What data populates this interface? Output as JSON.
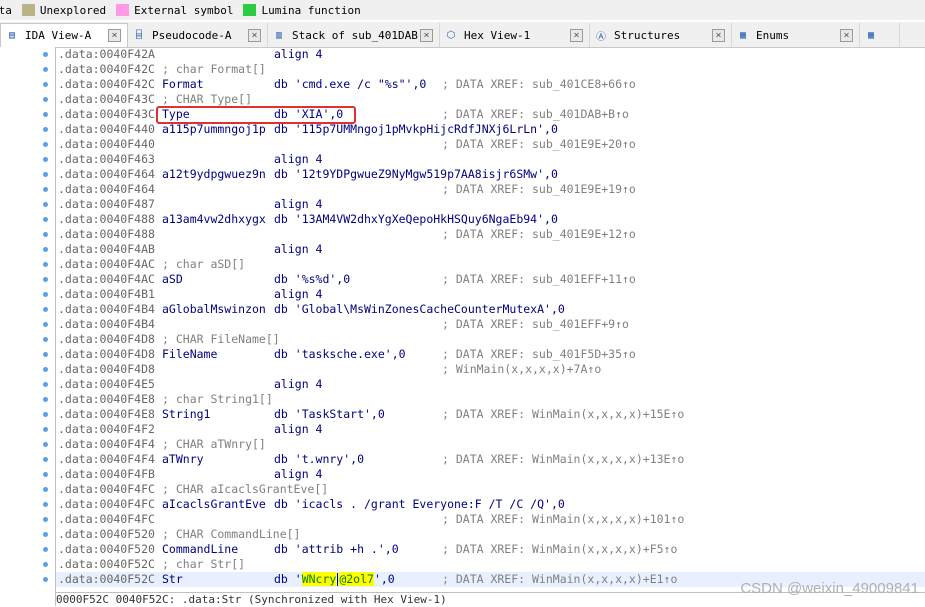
{
  "legend": [
    {
      "label": "ata",
      "color": "#f0f0f0"
    },
    {
      "label": "Unexplored",
      "color": "#bab38a"
    },
    {
      "label": "External symbol",
      "color": "#ff99e6"
    },
    {
      "label": "Lumina function",
      "color": "#2ecc40"
    }
  ],
  "tabs": [
    {
      "label": "IDA View-A",
      "icon": "list-icon",
      "active": true
    },
    {
      "label": "Pseudocode-A",
      "icon": "code-icon",
      "active": false
    },
    {
      "label": "Stack of sub_401DAB",
      "icon": "stack-icon",
      "active": false
    },
    {
      "label": "Hex View-1",
      "icon": "hex-icon",
      "active": false
    },
    {
      "label": "Structures",
      "icon": "struct-icon",
      "active": false
    },
    {
      "label": "Enums",
      "icon": "enum-icon",
      "active": false
    }
  ],
  "lines": [
    {
      "addr": ".data:0040F42A",
      "kind": "code",
      "name": "",
      "mnem": "align 4",
      "xref": ""
    },
    {
      "addr": ".data:0040F42C",
      "kind": "comment",
      "text": "; char Format[]"
    },
    {
      "addr": ".data:0040F42C",
      "kind": "code",
      "name": "Format",
      "mnem": "db 'cmd.exe /c \"%s\"',0",
      "xref": "; DATA XREF: sub_401CE8+66↑o"
    },
    {
      "addr": ".data:0040F43C",
      "kind": "comment",
      "text": "; CHAR Type[]"
    },
    {
      "addr": ".data:0040F43C",
      "kind": "code",
      "name": "Type",
      "mnem": "db 'XIA',0",
      "xref": "; DATA XREF: sub_401DAB+B↑o"
    },
    {
      "addr": ".data:0040F440",
      "kind": "code",
      "name": "a115p7ummngoj1p",
      "mnem": "db '115p7UMMngoj1pMvkpHijcRdfJNXj6LrLn',0",
      "xref": ""
    },
    {
      "addr": ".data:0040F440",
      "kind": "code",
      "name": "",
      "mnem": "",
      "xref": "; DATA XREF: sub_401E9E+20↑o"
    },
    {
      "addr": ".data:0040F463",
      "kind": "code",
      "name": "",
      "mnem": "align 4",
      "xref": ""
    },
    {
      "addr": ".data:0040F464",
      "kind": "code",
      "name": "a12t9ydpgwuez9n",
      "mnem": "db '12t9YDPgwueZ9NyMgw519p7AA8isjr6SMw',0",
      "xref": ""
    },
    {
      "addr": ".data:0040F464",
      "kind": "code",
      "name": "",
      "mnem": "",
      "xref": "; DATA XREF: sub_401E9E+19↑o"
    },
    {
      "addr": ".data:0040F487",
      "kind": "code",
      "name": "",
      "mnem": "align 4",
      "xref": ""
    },
    {
      "addr": ".data:0040F488",
      "kind": "code",
      "name": "a13am4vw2dhxygx",
      "mnem": "db '13AM4VW2dhxYgXeQepoHkHSQuy6NgaEb94',0",
      "xref": ""
    },
    {
      "addr": ".data:0040F488",
      "kind": "code",
      "name": "",
      "mnem": "",
      "xref": "; DATA XREF: sub_401E9E+12↑o"
    },
    {
      "addr": ".data:0040F4AB",
      "kind": "code",
      "name": "",
      "mnem": "align 4",
      "xref": ""
    },
    {
      "addr": ".data:0040F4AC",
      "kind": "comment",
      "text": "; char aSD[]"
    },
    {
      "addr": ".data:0040F4AC",
      "kind": "code",
      "name": "aSD",
      "mnem": "db '%s%d',0",
      "xref": "; DATA XREF: sub_401EFF+11↑o"
    },
    {
      "addr": ".data:0040F4B1",
      "kind": "code",
      "name": "",
      "mnem": "align 4",
      "xref": ""
    },
    {
      "addr": ".data:0040F4B4",
      "kind": "code",
      "name": "aGlobalMswinzon",
      "mnem": "db 'Global\\MsWinZonesCacheCounterMutexA',0",
      "xref": ""
    },
    {
      "addr": ".data:0040F4B4",
      "kind": "code",
      "name": "",
      "mnem": "",
      "xref": "; DATA XREF: sub_401EFF+9↑o"
    },
    {
      "addr": ".data:0040F4D8",
      "kind": "comment",
      "text": "; CHAR FileName[]"
    },
    {
      "addr": ".data:0040F4D8",
      "kind": "code",
      "name": "FileName",
      "mnem": "db 'tasksche.exe',0",
      "xref": "; DATA XREF: sub_401F5D+35↑o"
    },
    {
      "addr": ".data:0040F4D8",
      "kind": "code",
      "name": "",
      "mnem": "",
      "xref": "; WinMain(x,x,x,x)+7A↑o"
    },
    {
      "addr": ".data:0040F4E5",
      "kind": "code",
      "name": "",
      "mnem": "align 4",
      "xref": ""
    },
    {
      "addr": ".data:0040F4E8",
      "kind": "comment",
      "text": "; char String1[]"
    },
    {
      "addr": ".data:0040F4E8",
      "kind": "code",
      "name": "String1",
      "mnem": "db 'TaskStart',0",
      "xref": "; DATA XREF: WinMain(x,x,x,x)+15E↑o"
    },
    {
      "addr": ".data:0040F4F2",
      "kind": "code",
      "name": "",
      "mnem": "align 4",
      "xref": ""
    },
    {
      "addr": ".data:0040F4F4",
      "kind": "comment",
      "text": "; CHAR aTWnry[]"
    },
    {
      "addr": ".data:0040F4F4",
      "kind": "code",
      "name": "aTWnry",
      "mnem": "db 't.wnry',0",
      "xref": "; DATA XREF: WinMain(x,x,x,x)+13E↑o"
    },
    {
      "addr": ".data:0040F4FB",
      "kind": "code",
      "name": "",
      "mnem": "align 4",
      "xref": ""
    },
    {
      "addr": ".data:0040F4FC",
      "kind": "comment",
      "text": "; CHAR aIcaclsGrantEve[]"
    },
    {
      "addr": ".data:0040F4FC",
      "kind": "code",
      "name": "aIcaclsGrantEve",
      "mnem": "db 'icacls . /grant Everyone:F /T /C /Q',0",
      "xref": ""
    },
    {
      "addr": ".data:0040F4FC",
      "kind": "code",
      "name": "",
      "mnem": "",
      "xref": "; DATA XREF: WinMain(x,x,x,x)+101↑o"
    },
    {
      "addr": ".data:0040F520",
      "kind": "comment",
      "text": "; CHAR CommandLine[]"
    },
    {
      "addr": ".data:0040F520",
      "kind": "code",
      "name": "CommandLine",
      "mnem": "db 'attrib +h .',0",
      "xref": "; DATA XREF: WinMain(x,x,x,x)+F5↑o"
    },
    {
      "addr": ".data:0040F52C",
      "kind": "comment",
      "text": "; char Str[]"
    },
    {
      "addr": ".data:0040F52C",
      "kind": "current",
      "name": "Str",
      "mnem_pre": "db '",
      "mnem_hl1": "WNcry",
      "mnem_hl2": "@2ol7",
      "mnem_post": "',0",
      "xref": "; DATA XREF: WinMain(x,x,x,x)+E1↑o"
    }
  ],
  "status": "0000F52C 0040F52C: .data:Str (Synchronized with Hex View-1)",
  "watermark": "CSDN @weixin_49009841"
}
